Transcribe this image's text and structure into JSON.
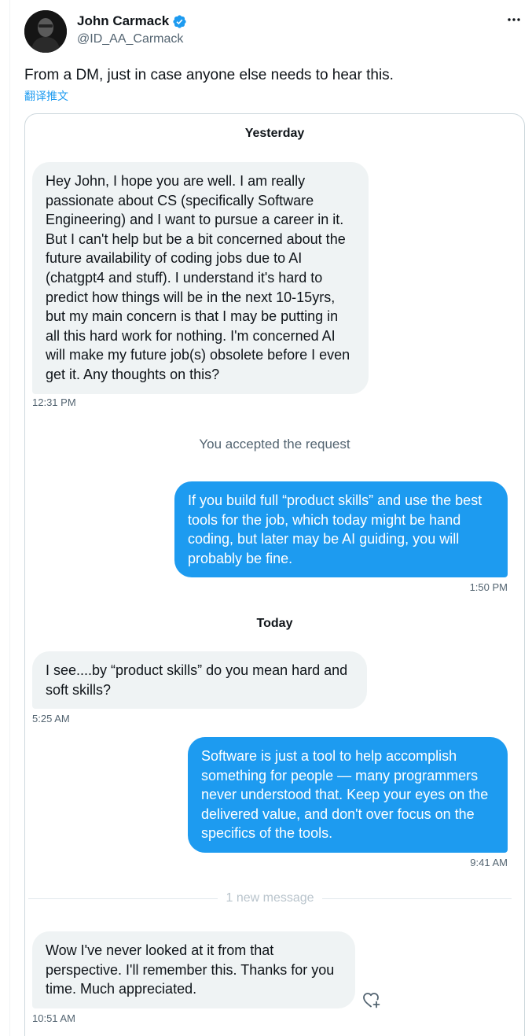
{
  "author": {
    "name": "John Carmack",
    "handle": "@ID_AA_Carmack",
    "verified_color": "#1d9bf0",
    "avatar": "avatar-photo",
    "more_icon": "more-horizontal-icon"
  },
  "tweet": {
    "text": "From a DM, just in case anyone else needs to hear this.",
    "translate_link": "翻译推文"
  },
  "conversation": {
    "day_yesterday": "Yesterday",
    "msg1": {
      "lines": [
        "Hey John, I hope you are well. I am really",
        "passionate about CS (specifically Software",
        "Engineering) and I want to pursue a career in it.",
        "But I can't help but be a bit concerned about the",
        "future availability of coding jobs due to AI",
        "(chatgpt4 and stuff). I understand it's hard to",
        "predict how things will be in the next 10-15yrs,",
        "but my main concern is that I may be putting in",
        "all this hard work for nothing. I'm concerned AI",
        "will make my future job(s) obsolete before I even",
        "get it. Any thoughts on this?"
      ],
      "time": "12:31 PM"
    },
    "accepted_note": "You accepted the request",
    "msg2": {
      "lines": [
        "If you build full “product skills” and use the best",
        "tools for the job, which today might be hand",
        "coding, but later may be AI guiding, you will",
        "probably be fine."
      ],
      "time": "1:50 PM"
    },
    "day_today": "Today",
    "msg3": {
      "lines": [
        "I see....by “product skills” do you mean hard and",
        "soft skills?"
      ],
      "time": "5:25 AM"
    },
    "msg4": {
      "lines": [
        "Software is just a tool to help accomplish",
        "something for people — many programmers",
        "never understood that. Keep your eyes on the",
        "delivered value, and don't over focus on the",
        "specifics of the tools."
      ],
      "time": "9:41 AM"
    },
    "new_message_divider": "1 new message",
    "msg5": {
      "lines": [
        "Wow I've never looked at it from that",
        "perspective. I'll remember this. Thanks for you",
        "time. Much appreciated."
      ],
      "time": "10:51 AM",
      "reaction_icon": "add-reaction-heart-icon"
    }
  },
  "colors": {
    "accent": "#1d9bf0",
    "incoming_bubble": "#eff3f4",
    "secondary_text": "#536471"
  }
}
